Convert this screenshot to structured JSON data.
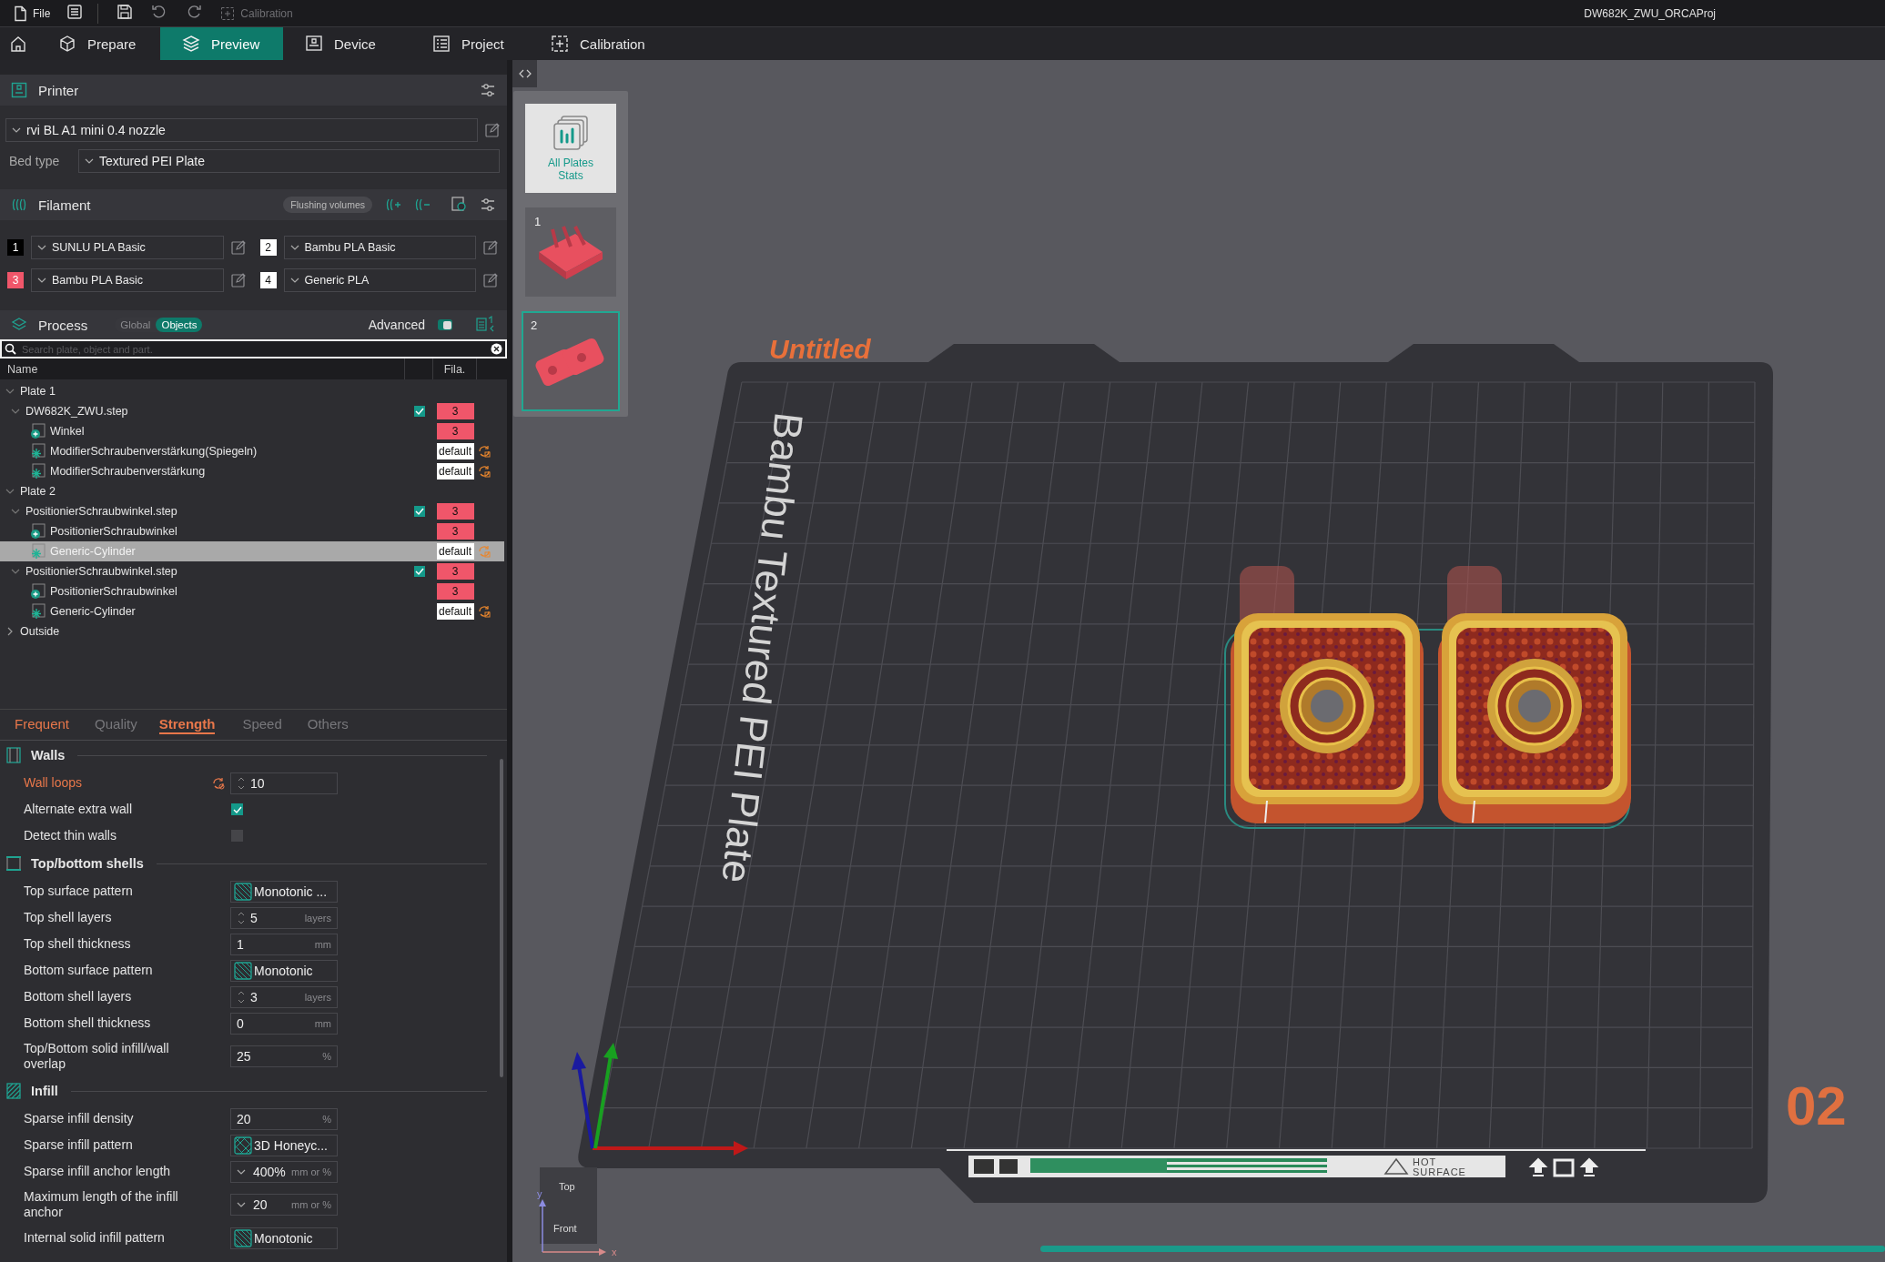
{
  "menu_bar": {
    "file_label": "File",
    "calibration": {
      "label": "Calibration",
      "disabled": true
    },
    "document_title": "DW682K_ZWU_ORCAProj"
  },
  "tabs": [
    {
      "label": "Prepare",
      "selected": false
    },
    {
      "label": "Preview",
      "selected": true
    },
    {
      "label": "Device",
      "selected": false
    },
    {
      "label": "Project",
      "selected": false
    },
    {
      "label": "Calibration",
      "selected": false
    }
  ],
  "printer": {
    "title": "Printer",
    "preset": "rvi BL A1 mini 0.4 nozzle",
    "bed_type_label": "Bed type",
    "bed_type": "Textured PEI Plate"
  },
  "filament": {
    "title": "Filament",
    "flushing_button": "Flushing volumes",
    "slots": [
      {
        "number": "1",
        "color": "#000000",
        "name": "SUNLU PLA Basic"
      },
      {
        "number": "2",
        "color": "#ffffff",
        "name": "Bambu PLA Basic"
      },
      {
        "number": "3",
        "color": "#f0566a",
        "name": "Bambu PLA Basic"
      },
      {
        "number": "4",
        "color": "#ffffff",
        "name": "Generic PLA"
      }
    ]
  },
  "process": {
    "title": "Process",
    "modes": [
      {
        "label": "Global",
        "selected": false
      },
      {
        "label": "Objects",
        "selected": true
      }
    ],
    "advanced_label": "Advanced",
    "advanced_on": true,
    "search_placeholder": "Search plate, object and part."
  },
  "object_list": {
    "columns": [
      "Name",
      "Fila."
    ],
    "rows": [
      {
        "name": "Plate 1",
        "expanded": true,
        "selected": false,
        "children": [
          {
            "name": "DW682K_ZWU.step",
            "expanded": true,
            "selected": false,
            "printable": true,
            "filament": "3",
            "color": "#f0566a",
            "children": [
              {
                "kind": "part",
                "name": "Winkel",
                "selected": false,
                "filament": "3",
                "color": "#f0566a",
                "has_settings": false
              },
              {
                "kind": "modifier",
                "name": "ModifierSchraubenverstärkung(Spiegeln)",
                "selected": false,
                "filament": "default",
                "color": "#ffffff",
                "has_settings": true
              },
              {
                "kind": "modifier",
                "name": "ModifierSchraubenverstärkung",
                "selected": false,
                "filament": "default",
                "color": "#ffffff",
                "has_settings": true
              }
            ]
          }
        ]
      },
      {
        "name": "Plate 2",
        "expanded": true,
        "selected": false,
        "children": [
          {
            "name": "PositionierSchraubwinkel.step",
            "expanded": true,
            "selected": false,
            "printable": true,
            "filament": "3",
            "color": "#f0566a",
            "children": [
              {
                "kind": "part",
                "name": "PositionierSchraubwinkel",
                "selected": false,
                "filament": "3",
                "color": "#f0566a",
                "has_settings": false
              },
              {
                "kind": "modifier",
                "name": "Generic-Cylinder",
                "selected": true,
                "filament": "default",
                "color": "#ffffff",
                "has_settings": true
              }
            ]
          },
          {
            "name": "PositionierSchraubwinkel.step",
            "expanded": true,
            "selected": false,
            "printable": true,
            "filament": "3",
            "color": "#f0566a",
            "children": [
              {
                "kind": "part",
                "name": "PositionierSchraubwinkel",
                "selected": false,
                "filament": "3",
                "color": "#f0566a",
                "has_settings": false
              },
              {
                "kind": "modifier",
                "name": "Generic-Cylinder",
                "selected": false,
                "filament": "default",
                "color": "#ffffff",
                "has_settings": true
              }
            ]
          }
        ]
      },
      {
        "name": "Outside",
        "expanded": false,
        "selected": false
      }
    ]
  },
  "settings_tabs": [
    {
      "label": "Frequent",
      "selected": false,
      "modified": true
    },
    {
      "label": "Quality",
      "selected": false,
      "modified": false
    },
    {
      "label": "Strength",
      "selected": true,
      "modified": true
    },
    {
      "label": "Speed",
      "selected": false,
      "modified": false
    },
    {
      "label": "Others",
      "selected": false,
      "modified": false
    }
  ],
  "settings": [
    {
      "title": "Walls",
      "rows": [
        {
          "kind": "spin",
          "label": "Wall loops",
          "value": "10",
          "modified": true
        },
        {
          "kind": "checkbox",
          "label": "Alternate extra wall",
          "checked": true,
          "modified": false
        },
        {
          "kind": "checkbox",
          "label": "Detect thin walls",
          "checked": false,
          "modified": false
        }
      ]
    },
    {
      "title": "Top/bottom shells",
      "rows": [
        {
          "kind": "pattern",
          "label": "Top surface pattern",
          "value": "Monotonic ...",
          "modified": false
        },
        {
          "kind": "spin",
          "label": "Top shell layers",
          "value": "5",
          "unit": "layers",
          "modified": false
        },
        {
          "kind": "number",
          "label": "Top shell thickness",
          "value": "1",
          "unit": "mm",
          "modified": false
        },
        {
          "kind": "pattern",
          "label": "Bottom surface pattern",
          "value": "Monotonic",
          "modified": false
        },
        {
          "kind": "spin",
          "label": "Bottom shell layers",
          "value": "3",
          "unit": "layers",
          "modified": false
        },
        {
          "kind": "number",
          "label": "Bottom shell thickness",
          "value": "0",
          "unit": "mm",
          "modified": false
        },
        {
          "kind": "number",
          "label": "Top/Bottom solid infill/wall overlap",
          "value": "25",
          "unit": "%",
          "modified": false
        }
      ]
    },
    {
      "title": "Infill",
      "rows": [
        {
          "kind": "number",
          "label": "Sparse infill density",
          "value": "20",
          "unit": "%",
          "modified": false
        },
        {
          "kind": "pattern",
          "label": "Sparse infill pattern",
          "value": "3D Honeyc...",
          "modified": false
        },
        {
          "kind": "combo",
          "label": "Sparse infill anchor length",
          "value": "400%",
          "unit": "mm or %",
          "modified": false
        },
        {
          "kind": "combo",
          "label": "Maximum length of the infill anchor",
          "value": "20",
          "unit": "mm or %",
          "modified": false
        },
        {
          "kind": "pattern",
          "label": "Internal solid infill pattern",
          "value": "Monotonic",
          "modified": false
        }
      ]
    }
  ],
  "viewport": {
    "plates": [
      {
        "kind": "stats",
        "label": "All Plates Stats",
        "selected": false
      },
      {
        "kind": "plate",
        "number": "1",
        "selected": false
      },
      {
        "kind": "plate",
        "number": "2",
        "selected": true
      }
    ],
    "plate_name": "Untitled",
    "bed_label": "Bambu Textured PEI Plate",
    "plate_number": "02",
    "warning_lines": [
      "HOT",
      "SURFACE"
    ],
    "view_cube": {
      "top": "Top",
      "front": "Front"
    },
    "mini_axes": {
      "y": "y",
      "x": "x"
    }
  }
}
